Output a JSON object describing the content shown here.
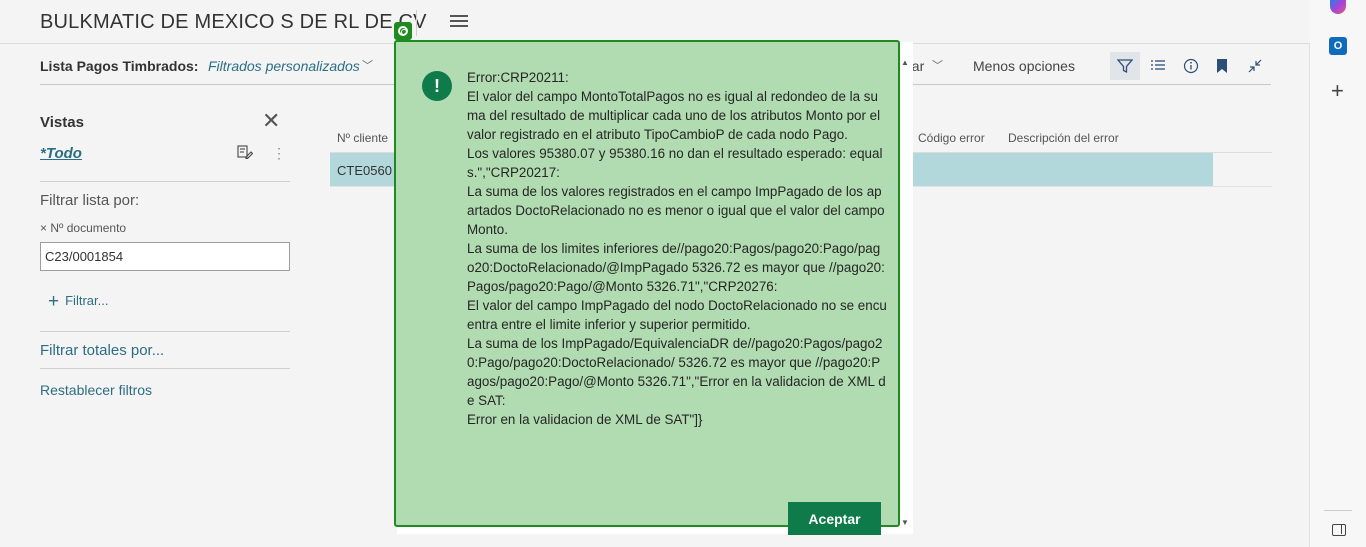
{
  "header": {
    "company": "BULKMATIC DE MEXICO S DE RL DE CV"
  },
  "action_bar": {
    "page_caption": "Lista Pagos Timbrados:",
    "filter_caption": "Filtrados personalizados",
    "partial_action": "gar",
    "less_options": "Menos opciones"
  },
  "filter_pane": {
    "views_title": "Vistas",
    "view_all": "*Todo",
    "filter_list_by": "Filtrar lista por:",
    "field_label": "× Nº documento",
    "field_value": "C23/0001854",
    "add_filter": "Filtrar...",
    "filter_totals": "Filtrar totales por...",
    "reset_filters": "Restablecer filtros"
  },
  "list": {
    "columns": [
      "Nº cliente",
      "Código error",
      "Descripción del error"
    ],
    "rows": [
      {
        "customer": "CTE0560"
      }
    ]
  },
  "dialog": {
    "message": "Error:CRP20211:\nEl valor del campo MontoTotalPagos no es igual al redondeo de la suma del resultado de multiplicar cada uno de los atributos Monto por el valor registrado en el atributo TipoCambioP de cada nodo Pago.\nLos valores 95380.07 y 95380.16 no dan el resultado esperado: equals.\",\"CRP20217:\nLa suma de los valores registrados en el campo ImpPagado de los apartados DoctoRelacionado no es menor o igual que el valor del campo Monto.\nLa suma de los limites inferiores de//pago20:Pagos/pago20:Pago/pago20:DoctoRelacionado/@ImpPagado 5326.72 es mayor que //pago20:Pagos/pago20:Pago/@Monto 5326.71\",\"CRP20276:\nEl valor del campo ImpPagado del nodo DoctoRelacionado no se encuentra entre el limite inferior y superior permitido.\nLa suma de los ImpPagado/EquivalenciaDR de//pago20:Pagos/pago20:Pago/pago20:DoctoRelacionado/ 5326.72 es mayor que //pago20:Pagos/pago20:Pago/@Monto 5326.71\",\"Error en la validacion de XML de SAT:\nError en la validacion de XML de SAT\"]}",
    "accept_label": "Aceptar",
    "warning_glyph": "!"
  },
  "icons": {
    "outlook_letter": "O"
  },
  "colors": {
    "dialog_bg": "#b1dbb1",
    "dialog_border": "#1f8a1f",
    "accent": "#0f7b4a",
    "link": "#2b6e83",
    "selected_row": "#b2d8dc"
  }
}
